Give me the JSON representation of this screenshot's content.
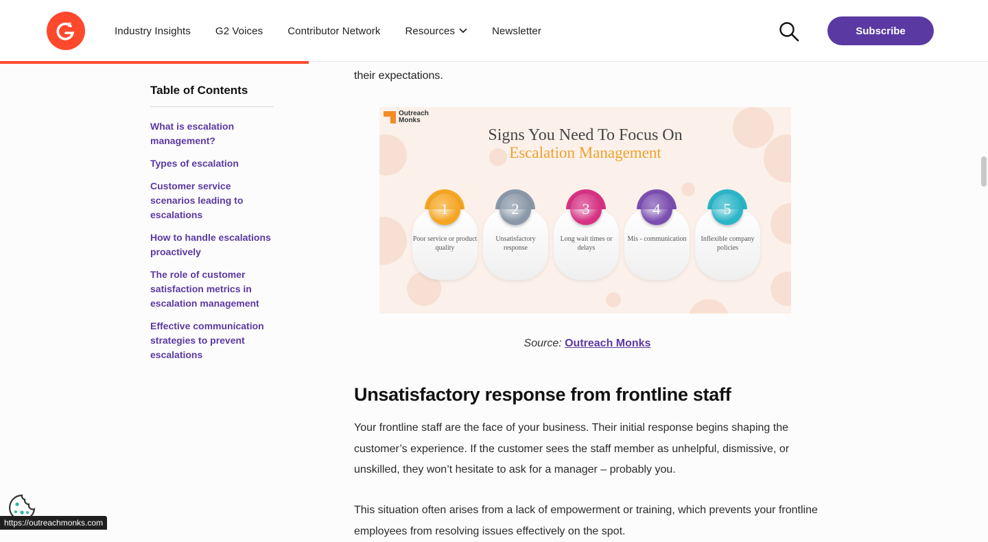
{
  "header": {
    "logo_text": "G2",
    "nav": [
      "Industry Insights",
      "G2 Voices",
      "Contributor Network",
      "Resources",
      "Newsletter"
    ],
    "subscribe_label": "Subscribe",
    "brand_color": "#ff492c",
    "accent_color": "#5a39a2"
  },
  "toc": {
    "title": "Table of Contents",
    "items": [
      "What is escalation management?",
      "Types of escalation",
      "Customer service scenarios leading to escalations",
      "How to handle escalations proactively",
      "The role of customer satisfaction metrics in escalation management",
      "Effective communication strategies to prevent escalations"
    ]
  },
  "article": {
    "top_text": "their expectations.",
    "figure": {
      "logo_line1": "Outreach",
      "logo_line2": "Monks",
      "title": "Signs You Need To Focus On",
      "subtitle": "Escalation Management",
      "cards": [
        {
          "num": "1",
          "label": "Poor service or product quality",
          "color": "#f5a623"
        },
        {
          "num": "2",
          "label": "Unsatisfactory response",
          "color": "#8a98a8"
        },
        {
          "num": "3",
          "label": "Long wait times or delays",
          "color": "#d63384"
        },
        {
          "num": "4",
          "label": "Mis - communication",
          "color": "#7b4fb0"
        },
        {
          "num": "5",
          "label": "Inflexible company policies",
          "color": "#2cb5c8"
        }
      ]
    },
    "caption_prefix": "Source: ",
    "caption_link": "Outreach Monks",
    "heading": "Unsatisfactory response from frontline staff",
    "para1": "Your frontline staff are the face of your business. Their initial response begins shaping the customer’s experience. If the customer sees the staff member as unhelpful, dismissive, or unskilled, they won’t hesitate to ask for a manager – probably you.",
    "para2": "This situation often arises from a lack of empowerment or training, which prevents your frontline employees from resolving issues effectively on the spot."
  },
  "status_url": "https://outreachmonks.com"
}
